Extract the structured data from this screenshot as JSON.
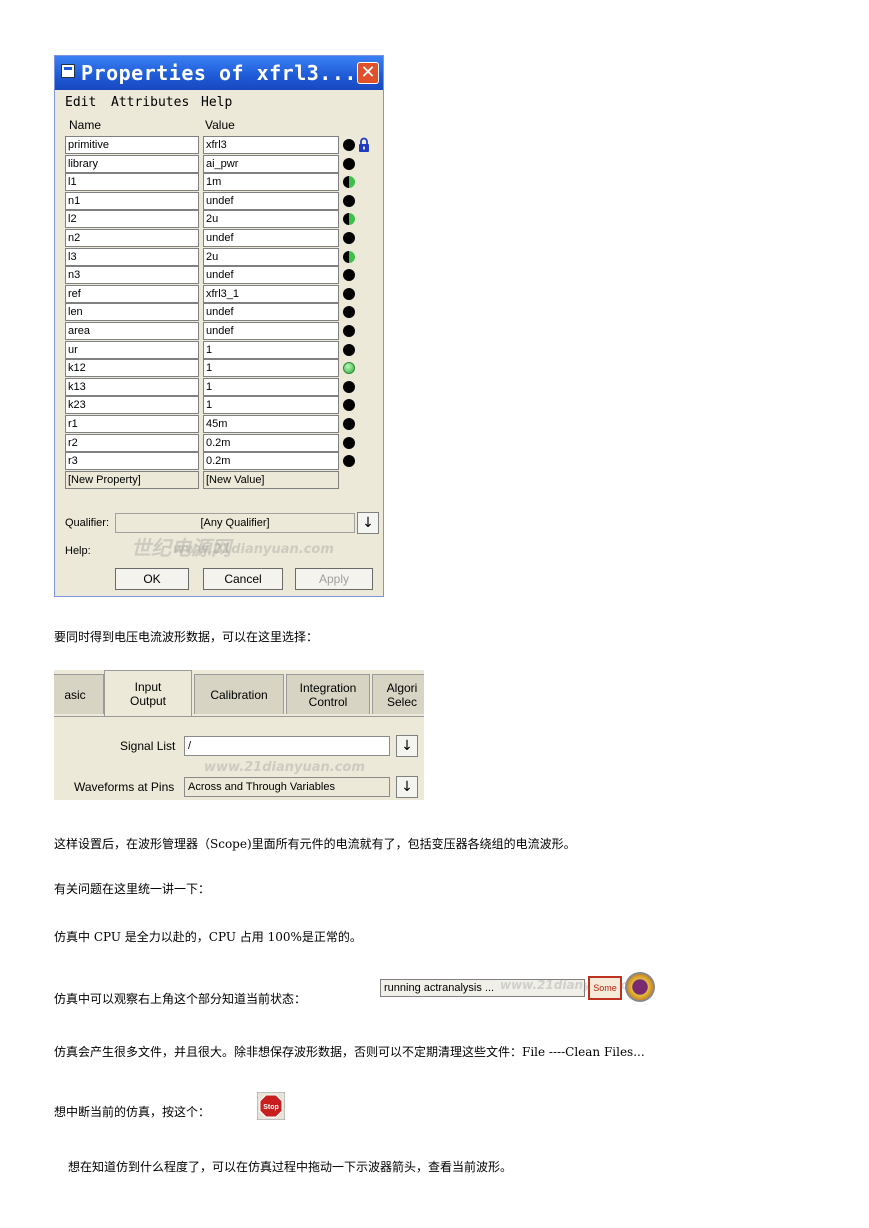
{
  "dialog": {
    "title": "Properties of xfrl3...",
    "menu": [
      "Edit",
      "Attributes",
      "Help"
    ],
    "columns": [
      "Name",
      "Value"
    ],
    "rows": [
      {
        "name": "primitive",
        "value": "xfrl3",
        "marker": "black",
        "lock": true
      },
      {
        "name": "library",
        "value": "ai_pwr",
        "marker": "black"
      },
      {
        "name": "l1",
        "value": "1m",
        "marker": "half"
      },
      {
        "name": "n1",
        "value": "undef",
        "marker": "black"
      },
      {
        "name": "l2",
        "value": "2u",
        "marker": "half"
      },
      {
        "name": "n2",
        "value": "undef",
        "marker": "black"
      },
      {
        "name": "l3",
        "value": "2u",
        "marker": "half"
      },
      {
        "name": "n3",
        "value": "undef",
        "marker": "black"
      },
      {
        "name": "ref",
        "value": "xfrl3_1",
        "marker": "black"
      },
      {
        "name": "len",
        "value": "undef",
        "marker": "black"
      },
      {
        "name": "area",
        "value": "undef",
        "marker": "black"
      },
      {
        "name": "ur",
        "value": "1",
        "marker": "black"
      },
      {
        "name": "k12",
        "value": "1",
        "marker": "green"
      },
      {
        "name": "k13",
        "value": "1",
        "marker": "black"
      },
      {
        "name": "k23",
        "value": "1",
        "marker": "black"
      },
      {
        "name": "r1",
        "value": "45m",
        "marker": "black"
      },
      {
        "name": "r2",
        "value": "0.2m",
        "marker": "black"
      },
      {
        "name": "r3",
        "value": "0.2m",
        "marker": "black"
      }
    ],
    "new_row": {
      "name": "[New Property]",
      "value": "[New Value]"
    },
    "qualifier_label": "Qualifier:",
    "qualifier_value": "[Any Qualifier]",
    "help_label": "Help:",
    "buttons": {
      "ok": "OK",
      "cancel": "Cancel",
      "apply": "Apply"
    },
    "watermark": [
      "世纪电源网",
      "www.21dianyuan.com"
    ]
  },
  "text": {
    "p1": "要同时得到电压电流波形数据，可以在这里选择：",
    "p2": "这样设置后，在波形管理器（Scope)里面所有元件的电流就有了，包括变压器各绕组的电流波形。",
    "p3": "有关问题在这里统一讲一下：",
    "p4": "仿真中 CPU 是全力以赴的，CPU 占用 100%是正常的。",
    "p5": "仿真中可以观察右上角这个部分知道当前状态：",
    "p6": "仿真会产生很多文件，并且很大。除非想保存波形数据，否则可以不定期清理这些文件：File   ----Clean Files...",
    "p7": "想中断当前的仿真，按这个：",
    "p8": "想在知道仿到什么程度了，可以在仿真过程中拖动一下示波器箭头，查看当前波形。"
  },
  "io_panel": {
    "tabs": [
      "asic",
      "Input\nOutput",
      "Calibration",
      "Integration\nControl",
      "Algori\nSelec"
    ],
    "signal_list_label": "Signal List",
    "signal_list_value": "/",
    "waveforms_label": "Waveforms at Pins",
    "waveforms_value": "Across and Through Variables",
    "watermark": "www.21dianyuan.com"
  },
  "status_widget": {
    "text": "running actranalysis ...",
    "button": "Some",
    "watermark": "www.21dianyuan.com"
  },
  "stop_button": {
    "label": "Stop",
    "color": "#c81e1e"
  }
}
